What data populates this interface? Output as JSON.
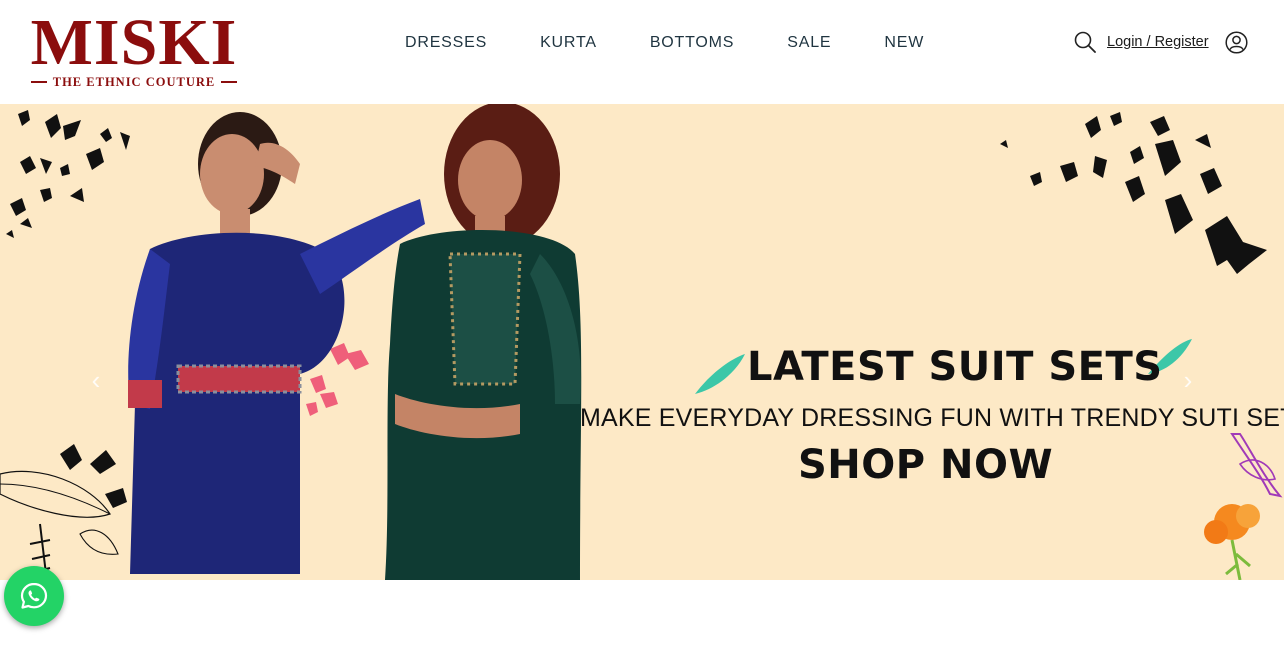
{
  "brand": {
    "name": "MISKI",
    "tagline": "THE ETHNIC COUTURE",
    "color": "#8b0d0d"
  },
  "nav": {
    "items": [
      {
        "label": "DRESSES"
      },
      {
        "label": "KURTA"
      },
      {
        "label": "BOTTOMS"
      },
      {
        "label": "SALE"
      },
      {
        "label": "NEW"
      }
    ]
  },
  "header_actions": {
    "search_icon": "search-icon",
    "login_label": "Login / Register",
    "user_icon": "user-icon"
  },
  "hero": {
    "title": "LATEST SUIT SETS",
    "subtitle": "MAKE EVERYDAY DRESSING FUN WITH TRENDY  SUTI SETS",
    "cta": "SHOP NOW",
    "background": "#fde9c6",
    "prev_icon": "‹",
    "next_icon": "›"
  },
  "whatsapp": {
    "icon": "whatsapp-icon",
    "color": "#23d366"
  }
}
